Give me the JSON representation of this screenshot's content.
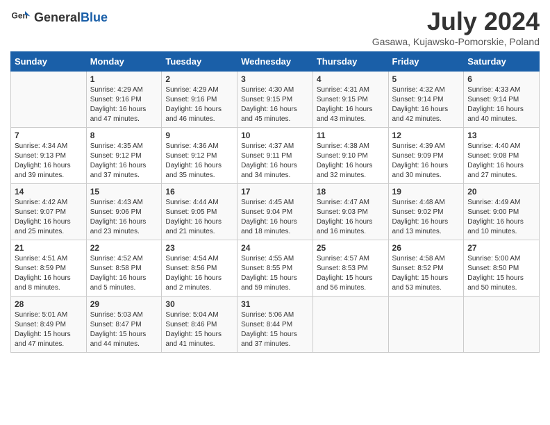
{
  "header": {
    "logo_general": "General",
    "logo_blue": "Blue",
    "title": "July 2024",
    "subtitle": "Gasawa, Kujawsko-Pomorskie, Poland"
  },
  "days_of_week": [
    "Sunday",
    "Monday",
    "Tuesday",
    "Wednesday",
    "Thursday",
    "Friday",
    "Saturday"
  ],
  "weeks": [
    [
      {
        "day": "",
        "info": ""
      },
      {
        "day": "1",
        "info": "Sunrise: 4:29 AM\nSunset: 9:16 PM\nDaylight: 16 hours\nand 47 minutes."
      },
      {
        "day": "2",
        "info": "Sunrise: 4:29 AM\nSunset: 9:16 PM\nDaylight: 16 hours\nand 46 minutes."
      },
      {
        "day": "3",
        "info": "Sunrise: 4:30 AM\nSunset: 9:15 PM\nDaylight: 16 hours\nand 45 minutes."
      },
      {
        "day": "4",
        "info": "Sunrise: 4:31 AM\nSunset: 9:15 PM\nDaylight: 16 hours\nand 43 minutes."
      },
      {
        "day": "5",
        "info": "Sunrise: 4:32 AM\nSunset: 9:14 PM\nDaylight: 16 hours\nand 42 minutes."
      },
      {
        "day": "6",
        "info": "Sunrise: 4:33 AM\nSunset: 9:14 PM\nDaylight: 16 hours\nand 40 minutes."
      }
    ],
    [
      {
        "day": "7",
        "info": "Sunrise: 4:34 AM\nSunset: 9:13 PM\nDaylight: 16 hours\nand 39 minutes."
      },
      {
        "day": "8",
        "info": "Sunrise: 4:35 AM\nSunset: 9:12 PM\nDaylight: 16 hours\nand 37 minutes."
      },
      {
        "day": "9",
        "info": "Sunrise: 4:36 AM\nSunset: 9:12 PM\nDaylight: 16 hours\nand 35 minutes."
      },
      {
        "day": "10",
        "info": "Sunrise: 4:37 AM\nSunset: 9:11 PM\nDaylight: 16 hours\nand 34 minutes."
      },
      {
        "day": "11",
        "info": "Sunrise: 4:38 AM\nSunset: 9:10 PM\nDaylight: 16 hours\nand 32 minutes."
      },
      {
        "day": "12",
        "info": "Sunrise: 4:39 AM\nSunset: 9:09 PM\nDaylight: 16 hours\nand 30 minutes."
      },
      {
        "day": "13",
        "info": "Sunrise: 4:40 AM\nSunset: 9:08 PM\nDaylight: 16 hours\nand 27 minutes."
      }
    ],
    [
      {
        "day": "14",
        "info": "Sunrise: 4:42 AM\nSunset: 9:07 PM\nDaylight: 16 hours\nand 25 minutes."
      },
      {
        "day": "15",
        "info": "Sunrise: 4:43 AM\nSunset: 9:06 PM\nDaylight: 16 hours\nand 23 minutes."
      },
      {
        "day": "16",
        "info": "Sunrise: 4:44 AM\nSunset: 9:05 PM\nDaylight: 16 hours\nand 21 minutes."
      },
      {
        "day": "17",
        "info": "Sunrise: 4:45 AM\nSunset: 9:04 PM\nDaylight: 16 hours\nand 18 minutes."
      },
      {
        "day": "18",
        "info": "Sunrise: 4:47 AM\nSunset: 9:03 PM\nDaylight: 16 hours\nand 16 minutes."
      },
      {
        "day": "19",
        "info": "Sunrise: 4:48 AM\nSunset: 9:02 PM\nDaylight: 16 hours\nand 13 minutes."
      },
      {
        "day": "20",
        "info": "Sunrise: 4:49 AM\nSunset: 9:00 PM\nDaylight: 16 hours\nand 10 minutes."
      }
    ],
    [
      {
        "day": "21",
        "info": "Sunrise: 4:51 AM\nSunset: 8:59 PM\nDaylight: 16 hours\nand 8 minutes."
      },
      {
        "day": "22",
        "info": "Sunrise: 4:52 AM\nSunset: 8:58 PM\nDaylight: 16 hours\nand 5 minutes."
      },
      {
        "day": "23",
        "info": "Sunrise: 4:54 AM\nSunset: 8:56 PM\nDaylight: 16 hours\nand 2 minutes."
      },
      {
        "day": "24",
        "info": "Sunrise: 4:55 AM\nSunset: 8:55 PM\nDaylight: 15 hours\nand 59 minutes."
      },
      {
        "day": "25",
        "info": "Sunrise: 4:57 AM\nSunset: 8:53 PM\nDaylight: 15 hours\nand 56 minutes."
      },
      {
        "day": "26",
        "info": "Sunrise: 4:58 AM\nSunset: 8:52 PM\nDaylight: 15 hours\nand 53 minutes."
      },
      {
        "day": "27",
        "info": "Sunrise: 5:00 AM\nSunset: 8:50 PM\nDaylight: 15 hours\nand 50 minutes."
      }
    ],
    [
      {
        "day": "28",
        "info": "Sunrise: 5:01 AM\nSunset: 8:49 PM\nDaylight: 15 hours\nand 47 minutes."
      },
      {
        "day": "29",
        "info": "Sunrise: 5:03 AM\nSunset: 8:47 PM\nDaylight: 15 hours\nand 44 minutes."
      },
      {
        "day": "30",
        "info": "Sunrise: 5:04 AM\nSunset: 8:46 PM\nDaylight: 15 hours\nand 41 minutes."
      },
      {
        "day": "31",
        "info": "Sunrise: 5:06 AM\nSunset: 8:44 PM\nDaylight: 15 hours\nand 37 minutes."
      },
      {
        "day": "",
        "info": ""
      },
      {
        "day": "",
        "info": ""
      },
      {
        "day": "",
        "info": ""
      }
    ]
  ]
}
